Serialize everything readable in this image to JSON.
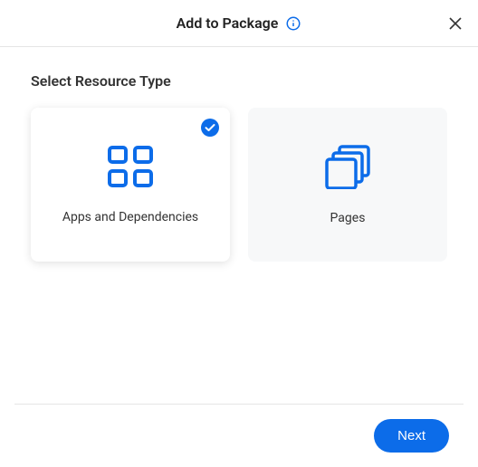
{
  "header": {
    "title": "Add to Package"
  },
  "section": {
    "title": "Select Resource Type"
  },
  "cards": {
    "apps": {
      "label": "Apps and Dependencies",
      "selected": true
    },
    "pages": {
      "label": "Pages",
      "selected": false
    }
  },
  "footer": {
    "next_label": "Next"
  },
  "colors": {
    "primary": "#0c6ce9"
  }
}
